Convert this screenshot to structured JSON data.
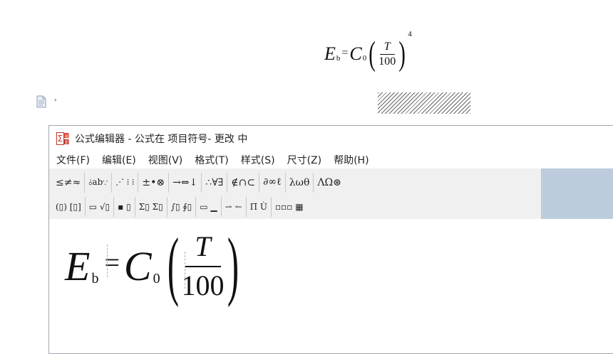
{
  "document": {
    "equation": {
      "base": "E",
      "sub": "b",
      "equals": "=",
      "coef": "C",
      "coef_sub": "0",
      "numerator": "T",
      "denominator": "100",
      "exponent": "4"
    },
    "paragraph_icon": "document-icon",
    "paragraph_caret": "▾"
  },
  "editor": {
    "title": "公式编辑器 - 公式在 项目符号- 更改 中",
    "app_icon": "equation-editor-icon",
    "menu": [
      {
        "label": "文件(F)"
      },
      {
        "label": "编辑(E)"
      },
      {
        "label": "视图(V)"
      },
      {
        "label": "格式(T)"
      },
      {
        "label": "样式(S)"
      },
      {
        "label": "尺寸(Z)"
      },
      {
        "label": "帮助(H)"
      }
    ],
    "toolbar_row1": [
      {
        "label": "≤≠≈",
        "icon": "relations-icon"
      },
      {
        "label": "⫰ab∵",
        "icon": "spaces-ellipses-icon"
      },
      {
        "label": "⋰ ⁞ ⁞",
        "icon": "embellishments-icon"
      },
      {
        "label": "±•⊗",
        "icon": "operators-icon"
      },
      {
        "label": "→⇔↓",
        "icon": "arrows-icon"
      },
      {
        "label": "∴∀∃",
        "icon": "logic-icon"
      },
      {
        "label": "∉∩⊂",
        "icon": "set-theory-icon"
      },
      {
        "label": "∂∞ℓ",
        "icon": "misc-symbols-icon"
      },
      {
        "label": "λωθ",
        "icon": "greek-lower-icon"
      },
      {
        "label": "ΛΩ⊛",
        "icon": "greek-upper-icon"
      }
    ],
    "toolbar_row2": [
      {
        "label": "(▯) [▯]",
        "icon": "fences-icon"
      },
      {
        "label": "▭ √▯",
        "icon": "fractions-radicals-icon"
      },
      {
        "label": "▪ ▯",
        "icon": "subscripts-icon"
      },
      {
        "label": "Σ▯ Σ▯",
        "icon": "summations-icon"
      },
      {
        "label": "∫▯ ∮▯",
        "icon": "integrals-icon"
      },
      {
        "label": "▭ ▁",
        "icon": "underbars-overbars-icon"
      },
      {
        "label": "⇀ ↼",
        "icon": "labeled-arrows-icon"
      },
      {
        "label": "Π̈ Ù",
        "icon": "products-icon"
      },
      {
        "label": "▫▫▫ ▦",
        "icon": "matrices-icon"
      }
    ]
  }
}
